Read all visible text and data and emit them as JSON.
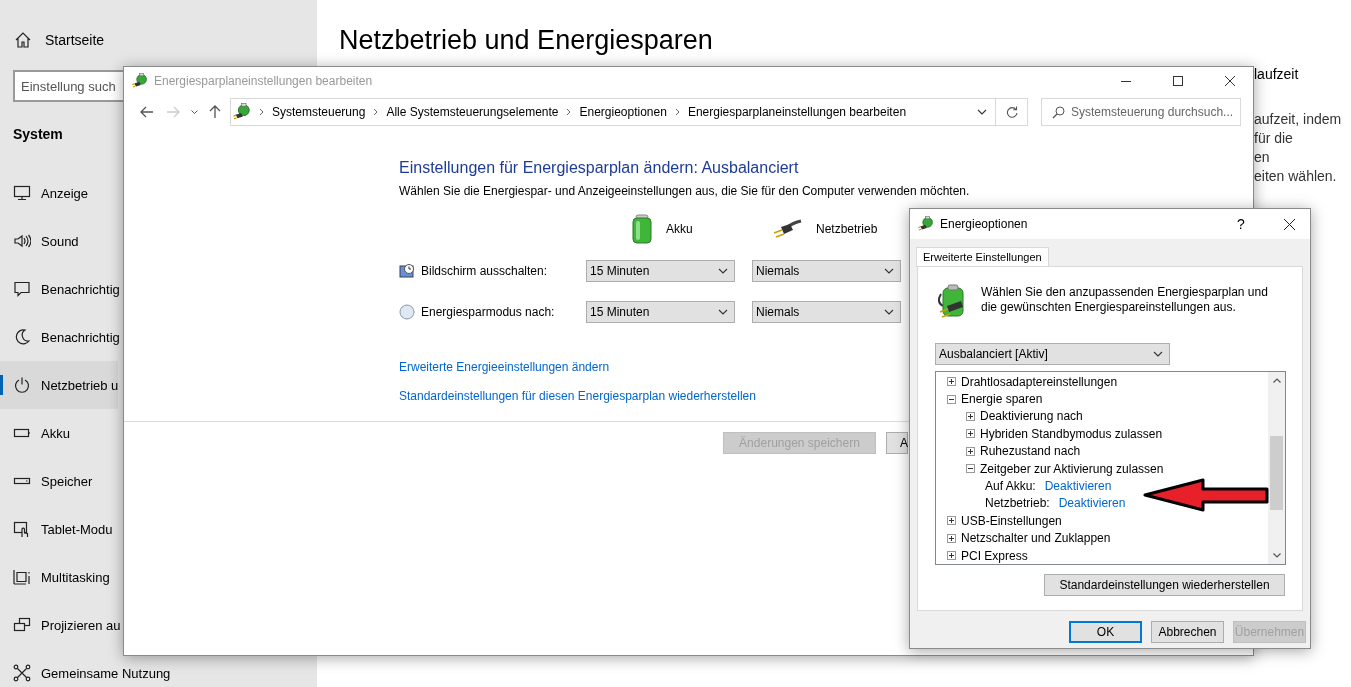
{
  "settings": {
    "home": "Startseite",
    "search": {
      "placeholder": "Einstellung such"
    },
    "section": "System",
    "nav": [
      {
        "label": "Anzeige",
        "selected": false
      },
      {
        "label": "Sound",
        "selected": false
      },
      {
        "label": "Benachrichtig",
        "selected": false
      },
      {
        "label": "Benachrichtig",
        "selected": false
      },
      {
        "label": "Netzbetrieb u",
        "selected": true
      },
      {
        "label": "Akku",
        "selected": false
      },
      {
        "label": "Speicher",
        "selected": false
      },
      {
        "label": "Tablet-Modu",
        "selected": false
      },
      {
        "label": "Multitasking",
        "selected": false
      },
      {
        "label": "Projizieren au",
        "selected": false
      },
      {
        "label": "Gemeinsame Nutzung",
        "selected": false
      }
    ],
    "page_title": "Netzbetrieb und Energiesparen",
    "side_heading": "laufzeit",
    "side_text": [
      "aufzeit, indem",
      "für die",
      "en",
      "eiten wählen."
    ]
  },
  "control_panel": {
    "title": "Energiesparplaneinstellungen bearbeiten",
    "breadcrumb": [
      "Systemsteuerung",
      "Alle Systemsteuerungselemente",
      "Energieoptionen",
      "Energiesparplaneinstellungen bearbeiten"
    ],
    "search": {
      "placeholder": "Systemsteuerung durchsuch..."
    },
    "heading": "Einstellungen für Energiesparplan ändern: Ausbalanciert",
    "description": "Wählen Sie die Energiespar- und Anzeigeeinstellungen aus, die Sie für den Computer verwenden möchten.",
    "columns": [
      "Akku",
      "Netzbetrieb"
    ],
    "rows": [
      {
        "label": "Bildschirm ausschalten:",
        "values": [
          "15 Minuten",
          "Niemals"
        ]
      },
      {
        "label": "Energiesparmodus nach:",
        "values": [
          "15 Minuten",
          "Niemals"
        ]
      }
    ],
    "links": [
      "Erweiterte Energieeinstellungen ändern",
      "Standardeinstellungen für diesen Energiesparplan wiederherstellen"
    ],
    "buttons": [
      {
        "label": "Änderungen speichern",
        "disabled": true
      },
      {
        "label": "A",
        "disabled": false
      }
    ]
  },
  "dialog": {
    "title": "Energieoptionen",
    "help": "?",
    "tabs": [
      {
        "label": "Erweiterte Einstellungen",
        "selected": true
      }
    ],
    "description": "Wählen Sie den anzupassenden Energiesparplan und die gewünschten Energiespareinstellungen aus.",
    "plan": "Ausbalanciert [Aktiv]",
    "tree": [
      {
        "kind": "group",
        "label": "Drahtlosadaptereinstellungen",
        "expanded": false
      },
      {
        "kind": "group",
        "label": "Energie sparen",
        "expanded": true,
        "children": [
          {
            "kind": "group",
            "label": "Deaktivierung nach",
            "expanded": false
          },
          {
            "kind": "group",
            "label": "Hybriden Standbymodus zulassen",
            "expanded": false
          },
          {
            "kind": "group",
            "label": "Ruhezustand nach",
            "expanded": false
          },
          {
            "kind": "group",
            "label": "Zeitgeber zur Aktivierung zulassen",
            "expanded": true,
            "children": [
              {
                "kind": "setting",
                "label": "Auf Akku:",
                "value": "Deaktivieren"
              },
              {
                "kind": "setting",
                "label": "Netzbetrieb:",
                "value": "Deaktivieren"
              }
            ]
          }
        ]
      },
      {
        "kind": "group",
        "label": "USB-Einstellungen",
        "expanded": false
      },
      {
        "kind": "group",
        "label": "Netzschalter und Zuklappen",
        "expanded": false
      },
      {
        "kind": "group",
        "label": "PCI Express",
        "expanded": false
      }
    ],
    "restore_button": "Standardeinstellungen wiederherstellen",
    "buttons": [
      {
        "label": "OK",
        "default": true,
        "disabled": false
      },
      {
        "label": "Abbrechen",
        "default": false,
        "disabled": false
      },
      {
        "label": "Übernehmen",
        "default": false,
        "disabled": true
      }
    ]
  }
}
